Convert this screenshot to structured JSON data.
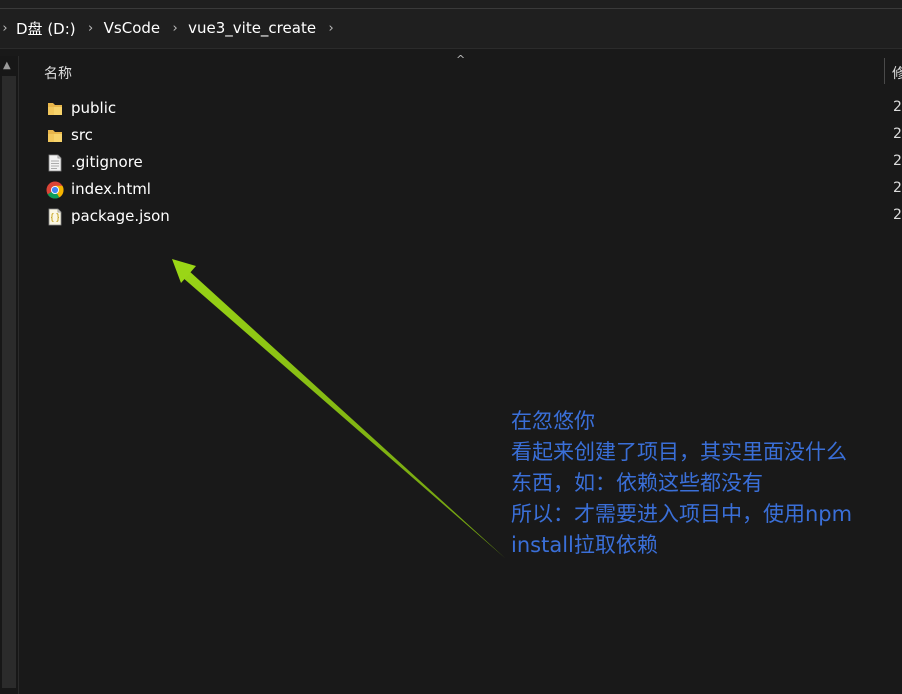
{
  "address_bar": {
    "crumbs": [
      "D盘 (D:)",
      "VsCode",
      "vue3_vite_create"
    ]
  },
  "columns": {
    "name": "名称",
    "modified": "修"
  },
  "files": [
    {
      "name": "public",
      "icon": "folder-icon",
      "date": "2"
    },
    {
      "name": "src",
      "icon": "folder-icon",
      "date": "2"
    },
    {
      "name": ".gitignore",
      "icon": "text-file-icon",
      "date": "2"
    },
    {
      "name": "index.html",
      "icon": "chrome-icon",
      "date": "2"
    },
    {
      "name": "package.json",
      "icon": "json-file-icon",
      "date": "2"
    }
  ],
  "annotation": {
    "lines": [
      "在忽悠你",
      "看起来创建了项目，其实里面没什么",
      "东西，如：依赖这些都没有",
      "所以：才需要进入项目中，使用npm",
      "install拉取依赖"
    ],
    "color": "#3a6fd8",
    "arrow_color": "#8fd400"
  }
}
